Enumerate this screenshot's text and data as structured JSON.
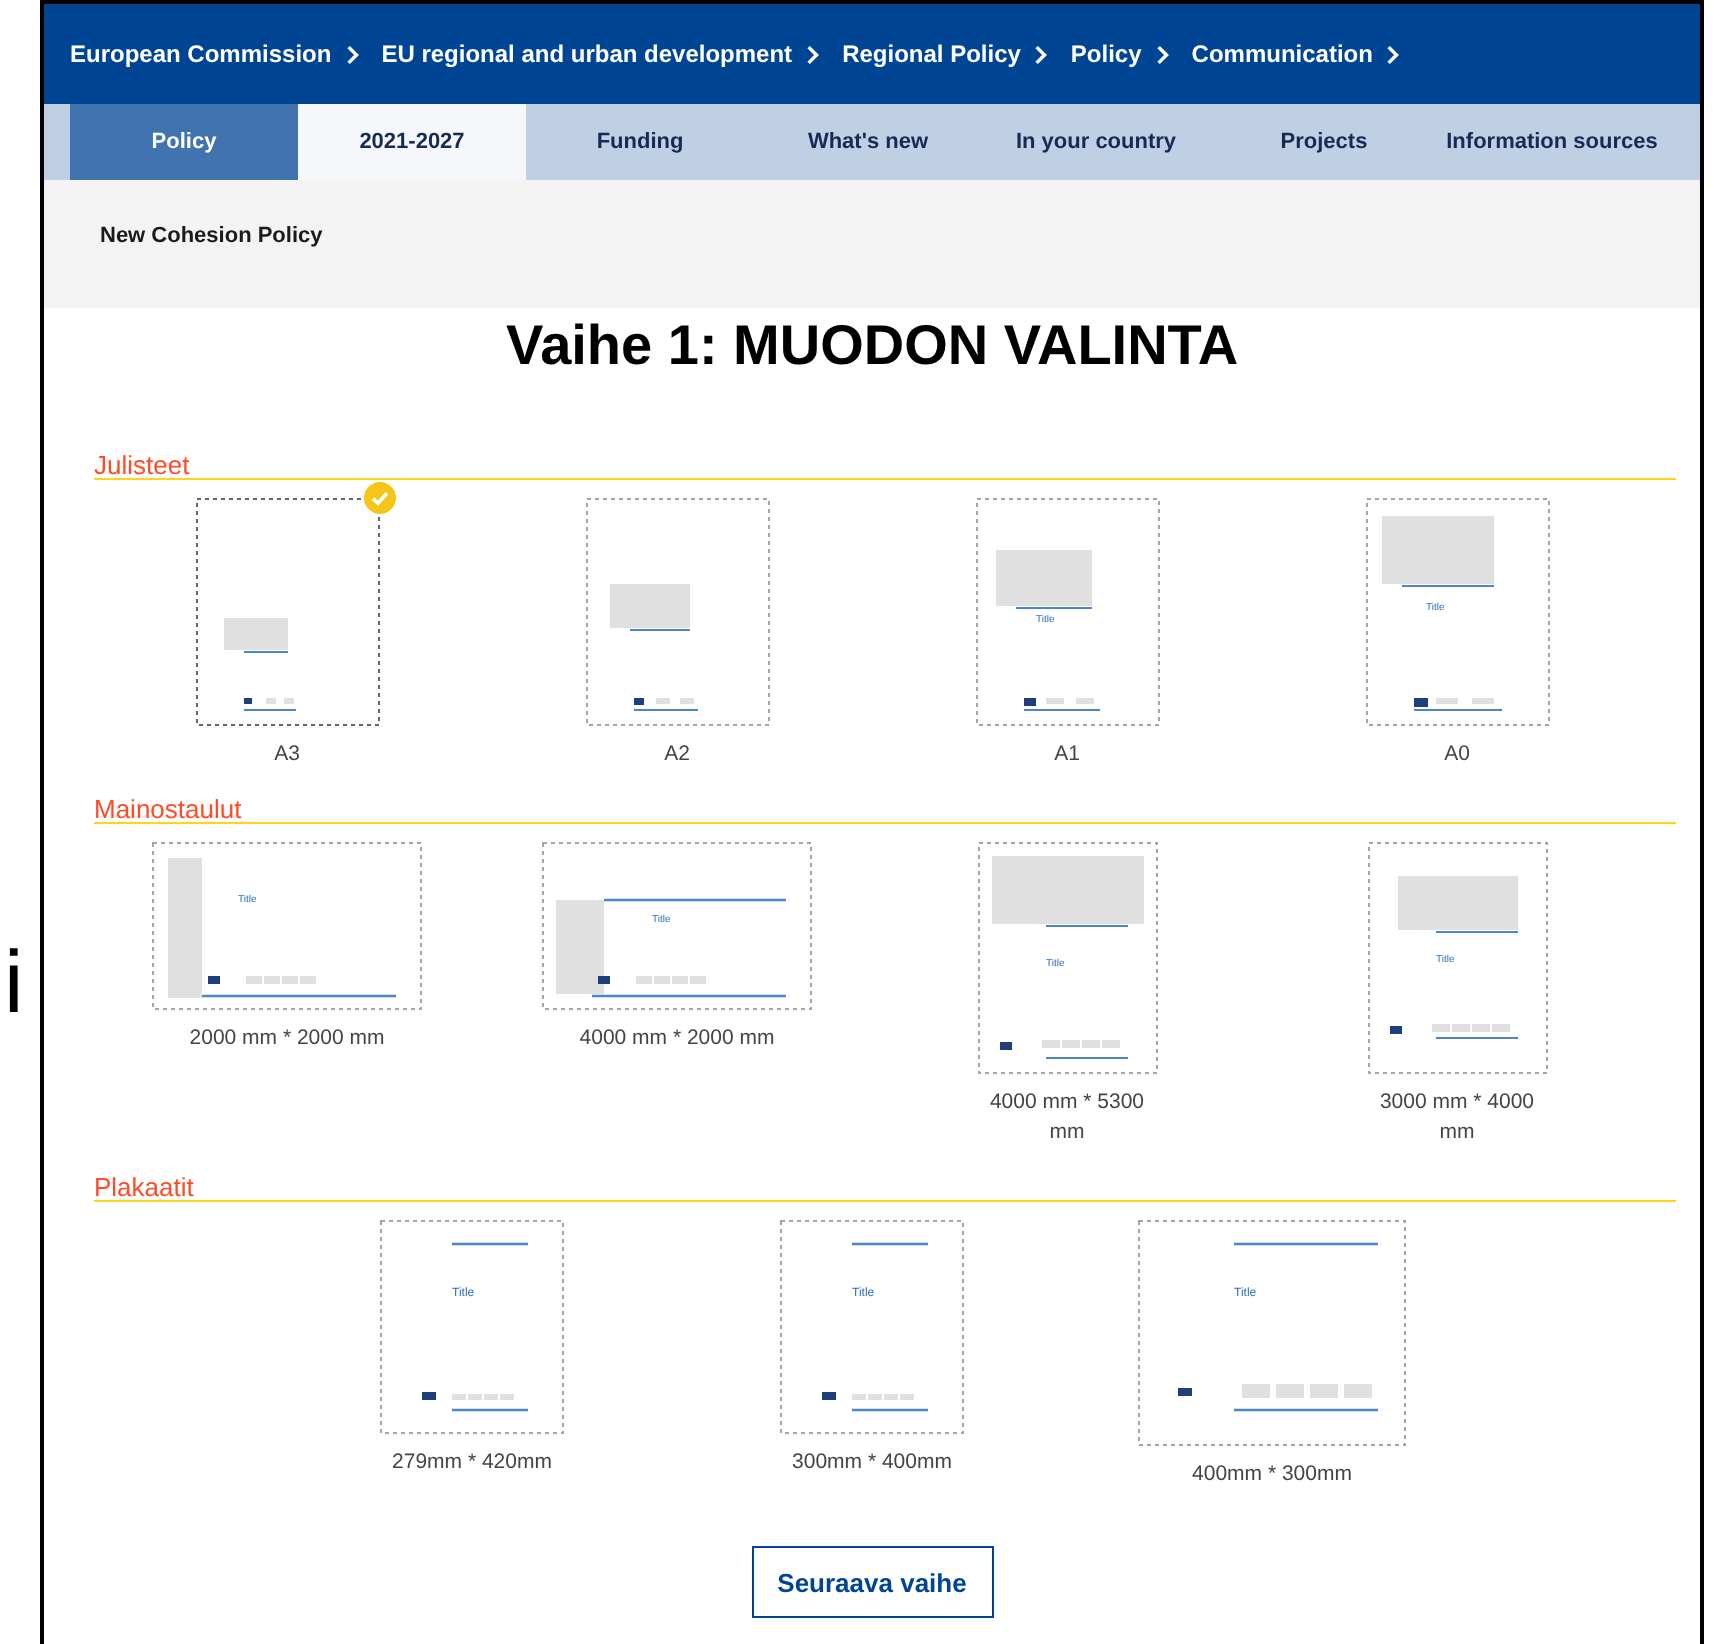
{
  "side_mark": "i",
  "breadcrumb": [
    "European Commission",
    "EU regional and urban development",
    "Regional Policy",
    "Policy",
    "Communication"
  ],
  "nav_tabs": [
    {
      "label": "Policy",
      "highlighted": true,
      "selected": false
    },
    {
      "label": "2021-2027",
      "highlighted": false,
      "selected": true
    },
    {
      "label": "Funding",
      "highlighted": false,
      "selected": false
    },
    {
      "label": "What's new",
      "highlighted": false,
      "selected": false
    },
    {
      "label": "In your country",
      "highlighted": false,
      "selected": false
    },
    {
      "label": "Projects",
      "highlighted": false,
      "selected": false
    },
    {
      "label": "Information sources",
      "highlighted": false,
      "selected": false
    }
  ],
  "sub_nav": [
    "New Cohesion Policy"
  ],
  "heading": "Vaihe 1: MUODON VALINTA",
  "sections": [
    {
      "title": "Julisteet",
      "items": [
        {
          "label": "A3",
          "kind": "portrait",
          "selected": true
        },
        {
          "label": "A2",
          "kind": "portrait",
          "selected": false
        },
        {
          "label": "A1",
          "kind": "portrait",
          "selected": false,
          "preview_title": "Title"
        },
        {
          "label": "A0",
          "kind": "portrait",
          "selected": false,
          "preview_title": "Title"
        }
      ]
    },
    {
      "title": "Mainostaulut",
      "items": [
        {
          "label": "2000 mm * 2000 mm",
          "kind": "wide",
          "selected": false,
          "preview_title": "Title"
        },
        {
          "label": "4000 mm * 2000 mm",
          "kind": "wide",
          "selected": false,
          "preview_title": "Title"
        },
        {
          "label": "4000 mm * 5300 mm",
          "kind": "tall",
          "selected": false,
          "preview_title": "Title"
        },
        {
          "label": "3000 mm * 4000 mm",
          "kind": "tall",
          "selected": false,
          "preview_title": "Title"
        }
      ]
    },
    {
      "title": "Plakaatit",
      "items": [
        {
          "label": "279mm * 420mm",
          "kind": "plain",
          "selected": false,
          "preview_title": "Title"
        },
        {
          "label": "300mm * 400mm",
          "kind": "plain",
          "selected": false,
          "preview_title": "Title"
        },
        {
          "label": "400mm * 300mm",
          "kind": "plainwide",
          "selected": false,
          "preview_title": "Title"
        }
      ]
    }
  ],
  "next_button": "Seuraava vaihe"
}
